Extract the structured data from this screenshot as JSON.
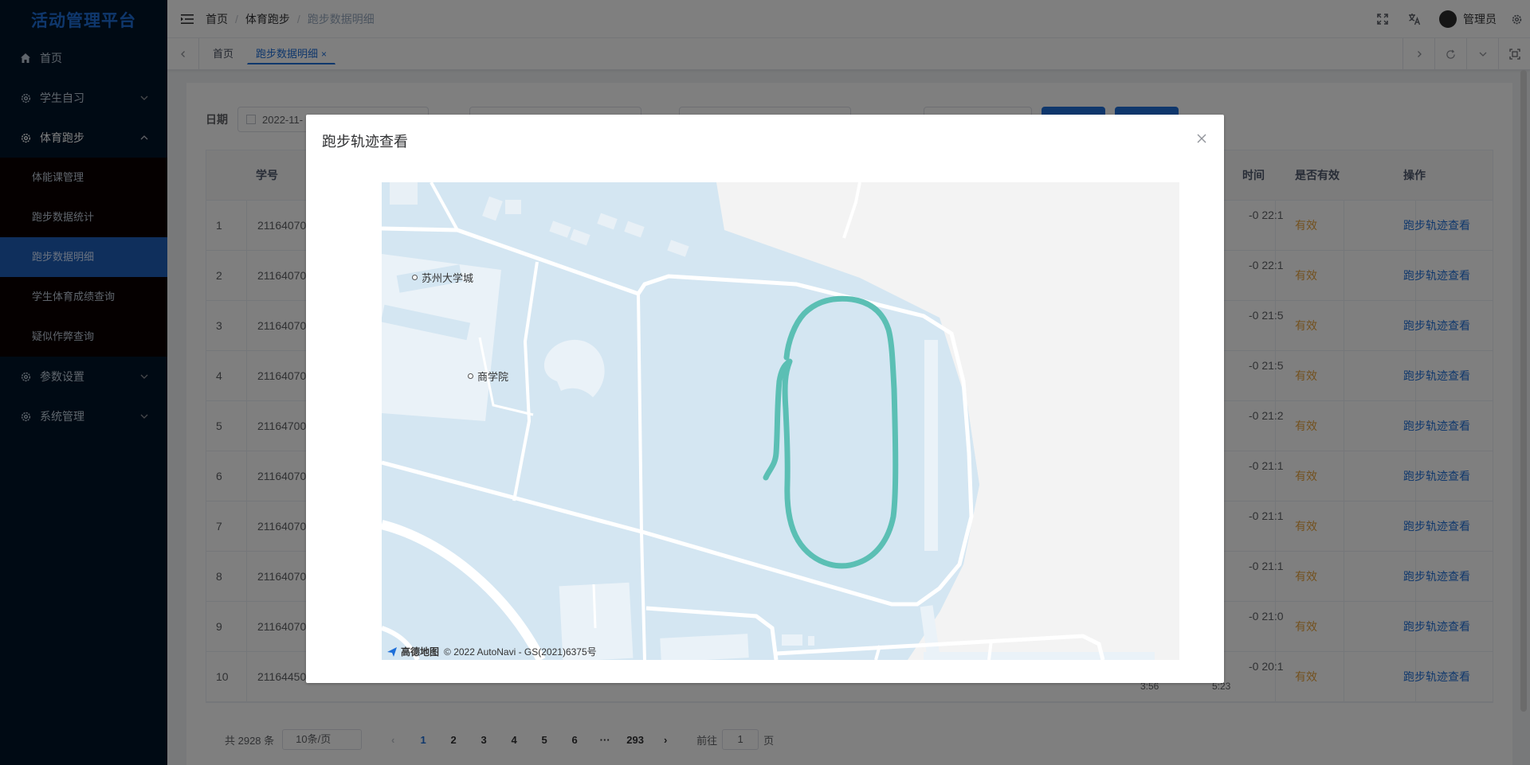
{
  "app": {
    "title": "活动管理平台"
  },
  "sidebar": {
    "items": [
      {
        "label": "首页",
        "icon": "home-icon"
      },
      {
        "label": "学生自习",
        "icon": "gear-icon"
      },
      {
        "label": "体育跑步",
        "icon": "gear-icon",
        "children": [
          {
            "label": "体能课管理"
          },
          {
            "label": "跑步数据统计"
          },
          {
            "label": "跑步数据明细"
          },
          {
            "label": "学生体育成绩查询"
          },
          {
            "label": "疑似作弊查询"
          }
        ]
      },
      {
        "label": "参数设置",
        "icon": "gear-icon"
      },
      {
        "label": "系统管理",
        "icon": "gear-icon"
      }
    ],
    "active_sub": "跑步数据明细"
  },
  "navbar": {
    "breadcrumb": [
      "首页",
      "体育跑步",
      "跑步数据明细"
    ],
    "separator": "/",
    "user_name": "管理员"
  },
  "tags": {
    "items": [
      {
        "label": "首页"
      },
      {
        "label": "跑步数据明细",
        "closable_mark": "×"
      }
    ]
  },
  "filter": {
    "date_label": "日期",
    "date_value": "2022-11-"
  },
  "table": {
    "headers": {
      "sid": "学号",
      "time": "时间",
      "valid": "是否有效",
      "op": "操作"
    },
    "rows": [
      {
        "idx": "1",
        "sid": "21164070",
        "time": "-0 22:1",
        "valid": "有效",
        "op": "跑步轨迹查看"
      },
      {
        "idx": "2",
        "sid": "21164070",
        "time": "-0 22:1",
        "valid": "有效",
        "op": "跑步轨迹查看"
      },
      {
        "idx": "3",
        "sid": "21164070",
        "time": "-0 21:5",
        "valid": "有效",
        "op": "跑步轨迹查看"
      },
      {
        "idx": "4",
        "sid": "21164070",
        "time": "-0 21:5",
        "valid": "有效",
        "op": "跑步轨迹查看"
      },
      {
        "idx": "5",
        "sid": "21164700",
        "time": "-0 21:2",
        "valid": "有效",
        "op": "跑步轨迹查看"
      },
      {
        "idx": "6",
        "sid": "21164070",
        "time": "-0 21:1",
        "valid": "有效",
        "op": "跑步轨迹查看"
      },
      {
        "idx": "7",
        "sid": "21164070",
        "time": "-0 21:1",
        "valid": "有效",
        "op": "跑步轨迹查看"
      },
      {
        "idx": "8",
        "sid": "21164070",
        "time": "-0 21:1",
        "valid": "有效",
        "op": "跑步轨迹查看"
      },
      {
        "idx": "9",
        "sid": "21164070",
        "time": "-0 21:0",
        "valid": "有效",
        "op": "跑步轨迹查看"
      },
      {
        "idx": "10",
        "sid": "21164450",
        "time": "-0 20:1",
        "valid": "有效",
        "op": "跑步轨迹查看",
        "extra_a": "3:56",
        "extra_b": "5:23"
      }
    ]
  },
  "pagination": {
    "total": "共 2928 条",
    "page_size": "10条/页",
    "pages": [
      "1",
      "2",
      "3",
      "4",
      "5",
      "6",
      "···",
      "293"
    ],
    "current": "1",
    "goto_prefix": "前往",
    "goto_value": "1",
    "goto_suffix": "页"
  },
  "dialog": {
    "title": "跑步轨迹查看",
    "map": {
      "labels": [
        "苏州大学城",
        "商学院"
      ],
      "credit_brand": "高德地图",
      "credit_text": "© 2022 AutoNavi - GS(2021)6375号",
      "track_color": "#5bbfb4",
      "water_color": "#d4e6f2"
    }
  },
  "colors": {
    "sidebar_bg": "#001529",
    "accent": "#1e6fd9",
    "valid": "#e6a23c"
  }
}
